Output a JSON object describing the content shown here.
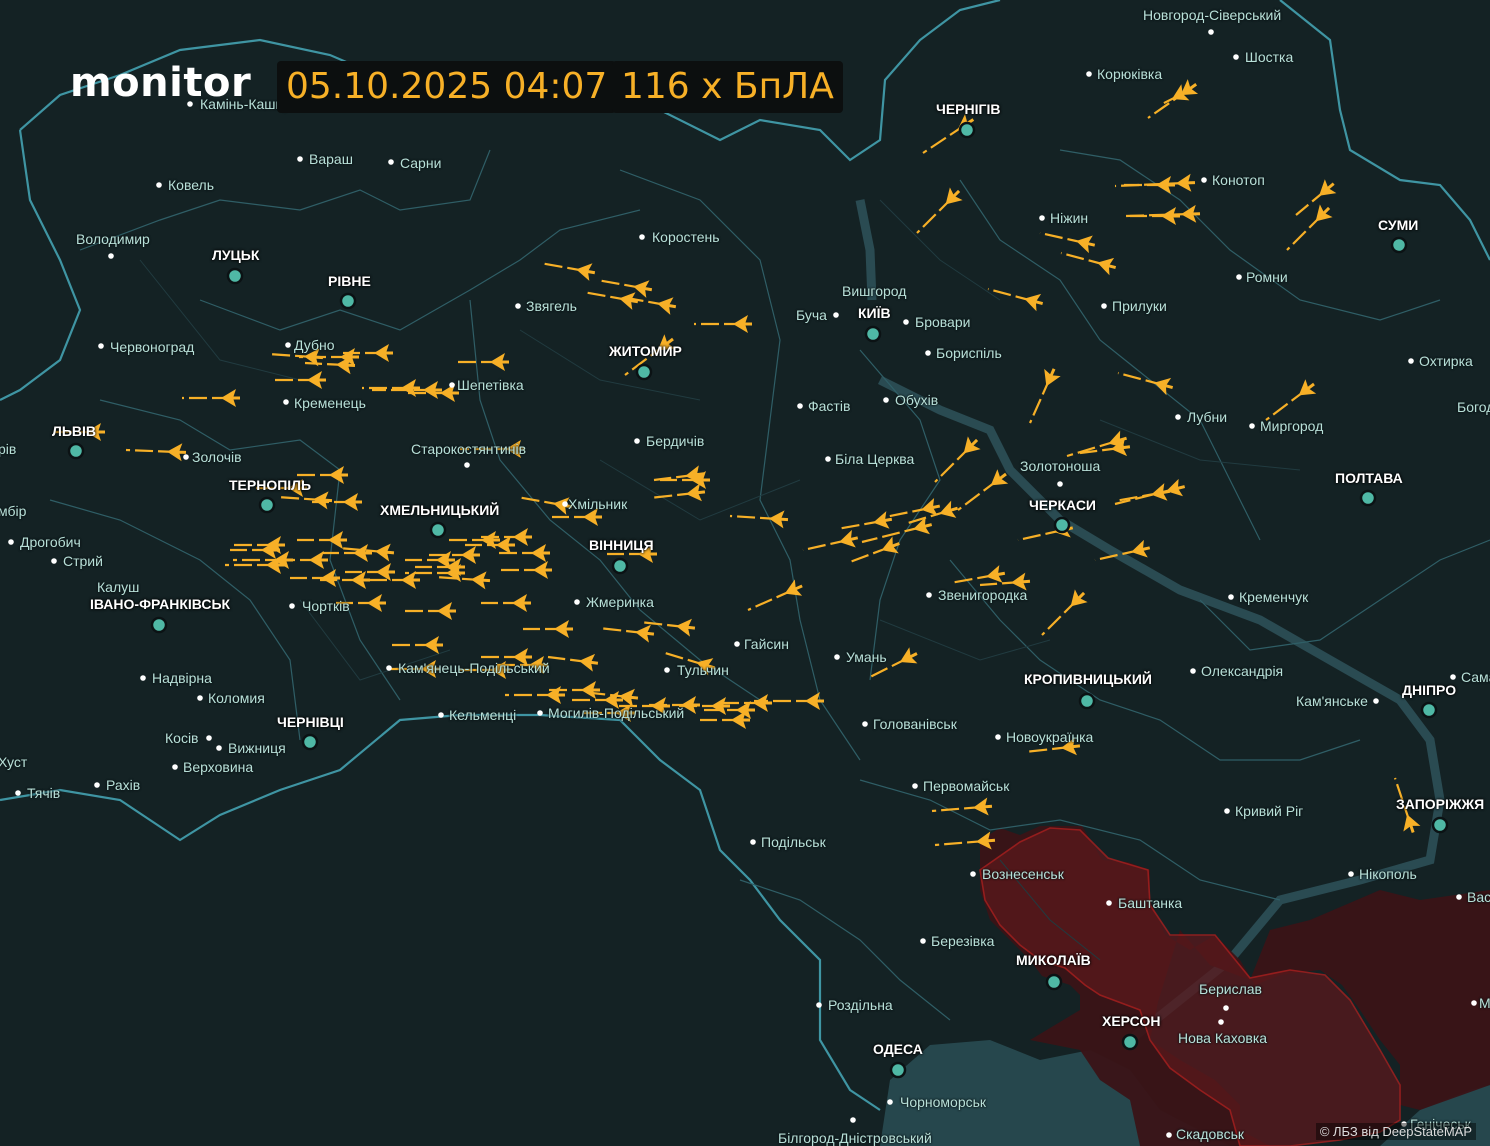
{
  "header": {
    "logo": "monitor",
    "datetime": "05.10.2025 04:07",
    "drone_count": "116 x БпЛА"
  },
  "credit": "© ЛБЗ від DeepStateMAP",
  "colors": {
    "background": "#142224",
    "border": "#3f95a3",
    "drone": "#f7b027",
    "occupied": "#4a1519",
    "occupied_border": "#b3201f",
    "city_marker": "#4fb8a5",
    "water": "#2a4b52"
  },
  "icons": {
    "drone": "shahed-drone-icon",
    "city": "city-dot-icon",
    "oblast_center": "oblast-center-marker-icon"
  },
  "drones_shown": 116,
  "oblast_centers": [
    "ЛУЦЬК",
    "РІВНЕ",
    "ЛЬВІВ",
    "ТЕРНОПІЛЬ",
    "ХМЕЛЬНИЦЬКИЙ",
    "ІВАНО-ФРАНКІВСЬК",
    "ЧЕРНІВЦІ",
    "ЖИТОМИР",
    "ВІННИЦЯ",
    "КИЇВ",
    "ЧЕРНІГІВ",
    "СУМИ",
    "ПОЛТАВА",
    "ЧЕРКАСИ",
    "КРОПИВНИЦЬКИЙ",
    "ДНІПРО",
    "ЗАПОРІЖЖЯ",
    "МИКОЛАЇВ",
    "ХЕРСОН",
    "ОДЕСА"
  ],
  "towns": [
    "Камінь-Каширський",
    "Вараш",
    "Сарни",
    "Ковель",
    "Володимир",
    "Червоноград",
    "Дубно",
    "Кременець",
    "Шепетівка",
    "Звягель",
    "Коростень",
    "Золочів",
    "Стрий",
    "Дрогобич",
    "Калуш",
    "Чортків",
    "Надвірна",
    "Коломия",
    "Косів",
    "Вижниця",
    "Верховина",
    "Рахів",
    "Тячів",
    "Кам'янець-Подільський",
    "Кельменці",
    "Могилів-Подільський",
    "Жмеринка",
    "Хмільник",
    "Старокостянтинів",
    "Бердичів",
    "Гайсин",
    "Тульчин",
    "Умань",
    "Біла Церква",
    "Фастів",
    "Обухів",
    "Бориспіль",
    "Бровари",
    "Буча",
    "Вишгород",
    "Ніжин",
    "Прилуки",
    "Конотоп",
    "Корюківка",
    "Шостка",
    "Новгород-Сіверський",
    "Ромни",
    "Лубни",
    "Миргород",
    "Охтирка",
    "Богод",
    "Золотоноша",
    "Звенигородка",
    "Кременчук",
    "Олександрія",
    "Кам'янське",
    "Голованівськ",
    "Новоукраїнка",
    "Первомайськ",
    "Подільськ",
    "Кривий Ріг",
    "Нікополь",
    "Вознесенськ",
    "Баштанка",
    "Березівка",
    "Роздільна",
    "Берислав",
    "Нова Каховка",
    "Чорноморськ",
    "Білгород-Дністровський",
    "Скадовськ",
    "Генічеськ",
    "Самар",
    "Вас",
    "М",
    "рів",
    "мбір",
    "Хуст"
  ]
}
